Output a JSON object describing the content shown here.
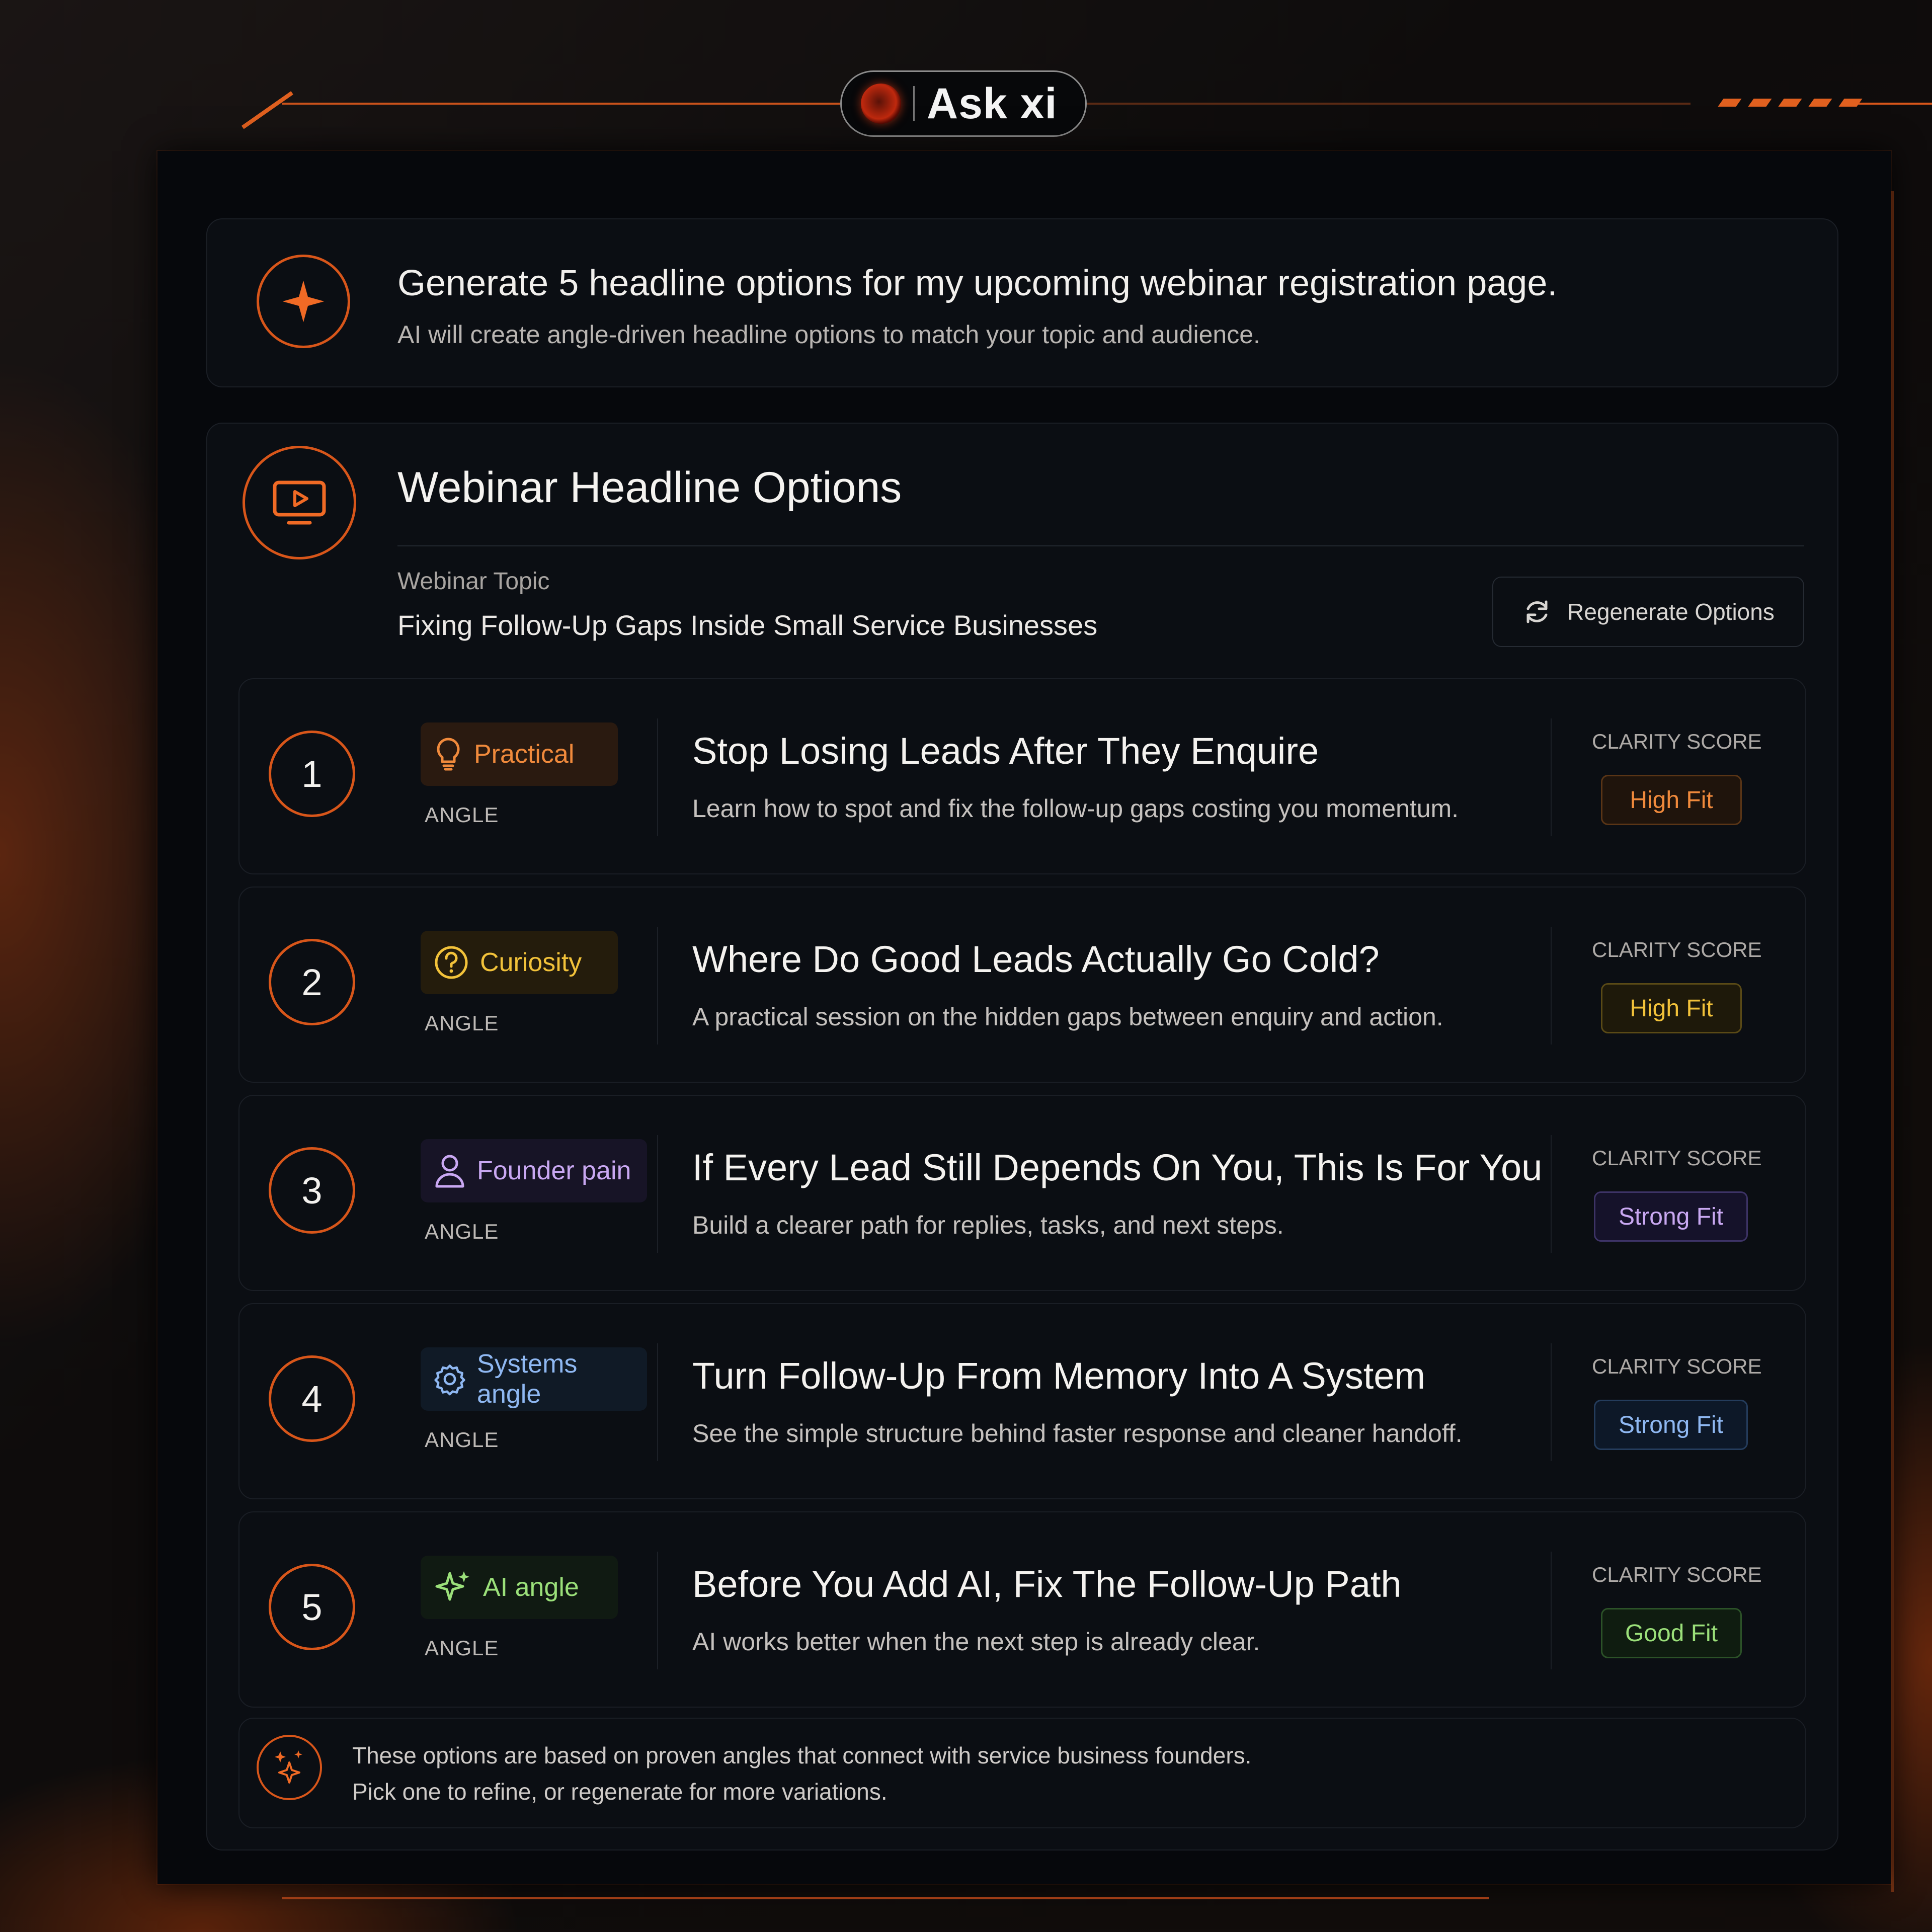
{
  "header": {
    "app_name": "Ask xi"
  },
  "prompt": {
    "title": "Generate 5 headline options for my upcoming webinar registration page.",
    "subtitle": "AI will create angle-driven headline options to match your topic and audience."
  },
  "options_panel": {
    "title": "Webinar Headline Options",
    "topic_label": "Webinar Topic",
    "topic_value": "Fixing Follow-Up Gaps Inside Small Service Businesses",
    "regenerate_label": "Regenerate Options"
  },
  "options": [
    {
      "number": "1",
      "angle": "Practical",
      "angle_caption": "ANGLE",
      "icon": "lightbulb-icon",
      "title": "Stop Losing Leads After They Enquire",
      "subtitle": "Learn how to spot and fix the follow-up gaps costing you momentum.",
      "score_label": "CLARITY SCORE",
      "fit": "High Fit",
      "accent": "#f08a3c"
    },
    {
      "number": "2",
      "angle": "Curiosity",
      "angle_caption": "ANGLE",
      "icon": "question-icon",
      "title": "Where Do Good Leads Actually Go Cold?",
      "subtitle": "A practical session on the hidden gaps between enquiry and action.",
      "score_label": "CLARITY SCORE",
      "fit": "High Fit",
      "accent": "#f2c23a"
    },
    {
      "number": "3",
      "angle": "Founder pain",
      "angle_caption": "ANGLE",
      "icon": "person-icon",
      "title": "If Every Lead Still Depends On You, This Is For You",
      "subtitle": "Build a clearer path for replies, tasks, and next steps.",
      "score_label": "CLARITY SCORE",
      "fit": "Strong Fit",
      "accent": "#c9a8f2"
    },
    {
      "number": "4",
      "angle": "Systems angle",
      "angle_caption": "ANGLE",
      "icon": "gear-icon",
      "title": "Turn Follow-Up From Memory Into A System",
      "subtitle": "See the simple structure behind faster response and cleaner handoff.",
      "score_label": "CLARITY SCORE",
      "fit": "Strong Fit",
      "accent": "#8fb8f2"
    },
    {
      "number": "5",
      "angle": "AI angle",
      "angle_caption": "ANGLE",
      "icon": "sparkle-icon",
      "title": "Before You Add AI, Fix The Follow-Up Path",
      "subtitle": "AI works better when the next step is already clear.",
      "score_label": "CLARITY SCORE",
      "fit": "Good Fit",
      "accent": "#9be07a"
    }
  ],
  "footer_note": {
    "line1": "These options are based on proven angles that connect with service business founders.",
    "line2": "Pick one to refine, or regenerate for more variations."
  },
  "colors": {
    "accent_orange": "#d8561a",
    "panel_bg": "#06080c",
    "card_bg": "#0b0e13"
  }
}
